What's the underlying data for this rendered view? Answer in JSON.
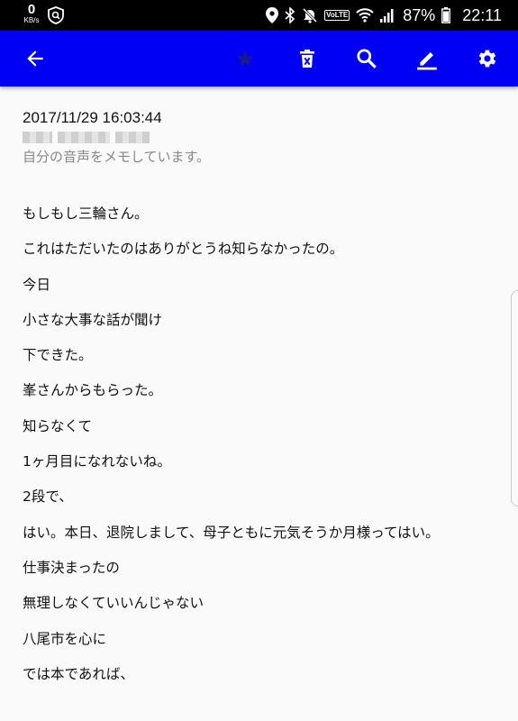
{
  "status_bar": {
    "net_speed_value": "0",
    "net_speed_unit": "KB/s",
    "volte_label": "VoLTE",
    "battery": "87%",
    "time": "22:11"
  },
  "toolbar": {
    "bg_color": "#0000f5",
    "icons": [
      "back-arrow-icon",
      "star-icon",
      "delete-icon",
      "search-icon",
      "edit-icon",
      "settings-icon"
    ]
  },
  "memo": {
    "timestamp": "2017/11/29 16:03:44",
    "note": "自分の音声をメモしています。",
    "lines": [
      "もしもし三輪さん。",
      "これはただいたのはありがとうね知らなかったの。",
      "今日",
      "小さな大事な話が聞け",
      "下できた。",
      "峯さんからもらった。",
      "知らなくて",
      "1ヶ月目になれないね。",
      "2段で、",
      "はい。本日、退院しまして、母子ともに元気そうか月様ってはい。",
      "仕事決まったの",
      "無理しなくていいんじゃない",
      "八尾市を心に",
      "では本であれば、"
    ]
  }
}
